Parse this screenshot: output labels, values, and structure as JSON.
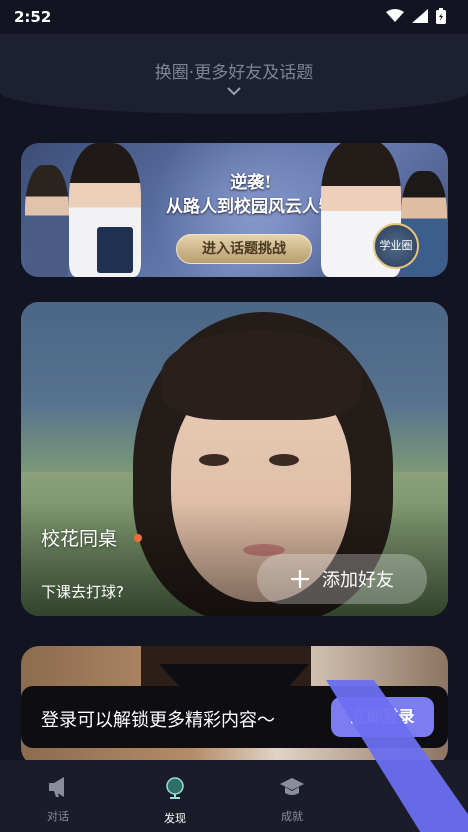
{
  "status_bar": {
    "time": "2:52"
  },
  "header": {
    "title": "换圈·更多好友及话题"
  },
  "banner": {
    "headline_line1": "逆袭!",
    "headline_line2": "从路人到校园风云人物",
    "cta": "进入话题挑战",
    "badge": "学业圈"
  },
  "profile": {
    "name": "校花同桌",
    "status": "下课去打球?",
    "add_friend": "添加好友",
    "add_icon": "plus-icon"
  },
  "login_prompt": {
    "message": "登录可以解锁更多精彩内容～",
    "button": "立即登录"
  },
  "tabs": [
    {
      "label": "对话",
      "icon": "megaphone-icon",
      "active": false
    },
    {
      "label": "发现",
      "icon": "globe-icon",
      "active": true
    },
    {
      "label": "成就",
      "icon": "graduation-cap-icon",
      "active": false
    }
  ],
  "colors": {
    "background": "#121521",
    "accent": "#7c7df0",
    "tab_active": "#ffffff",
    "tab_inactive": "#8a8e9c"
  }
}
